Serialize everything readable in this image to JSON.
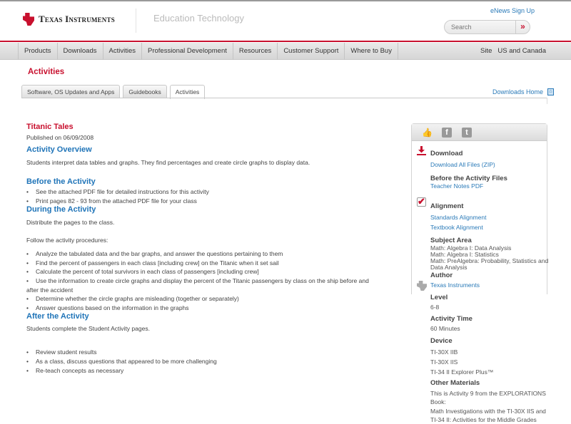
{
  "header": {
    "logo_text": "Texas Instruments",
    "section_title": "Education Technology",
    "enews_link": "eNews Sign Up",
    "search_placeholder": "Search",
    "search_go": "»"
  },
  "nav": {
    "items": [
      "Products",
      "Downloads",
      "Activities",
      "Professional Development",
      "Resources",
      "Customer Support",
      "Where to Buy"
    ],
    "site_label": "Site",
    "site_value": "US and Canada"
  },
  "page": {
    "heading": "Activities",
    "tabs": [
      "Software, OS Updates and Apps",
      "Guidebooks",
      "Activities"
    ],
    "downloads_home": "Downloads Home"
  },
  "activity": {
    "title": "Titanic Tales",
    "published": "Published on 06/09/2008",
    "overview_heading": "Activity Overview",
    "overview_text": "Students interpret data tables and graphs. They find percentages and create circle graphs to display data.",
    "before_heading": "Before the Activity",
    "before_items": [
      "See the attached PDF file for detailed instructions for this activity",
      "Print pages 82 - 93 from the attached PDF file for your class"
    ],
    "during_heading": "During the Activity",
    "during_intro": "Distribute the pages to the class.",
    "during_follow": "Follow the activity procedures:",
    "during_items": [
      "Analyze the tabulated data and the bar graphs, and answer the questions pertaining to them",
      "Find the percent of passengers in each class [including crew] on the Titanic when it set sail",
      "Calculate the percent of total survivors in each class of passengers [including crew]",
      "Use the information to create circle graphs and display the percent of the Titanic passengers by class on the ship before and after the accident",
      "Determine whether the circle graphs are misleading (together or separately)",
      "Answer questions based on the information in the graphs"
    ],
    "after_heading": "After the Activity",
    "after_intro": "Students complete the Student Activity pages.",
    "after_items": [
      "Review student results",
      "As a class, discuss questions that appeared to be more challenging",
      "Re-teach concepts as necessary"
    ]
  },
  "sidebar": {
    "download_heading": "Download",
    "download_all": "Download All Files (ZIP)",
    "before_files_heading": "Before the Activity Files",
    "teacher_notes": "Teacher Notes PDF",
    "alignment_heading": "Alignment",
    "standards": "Standards Alignment",
    "textbook": "Textbook Alignment",
    "subject_heading": "Subject Area",
    "subjects": [
      "Math: Algebra I: Data Analysis",
      "Math: Algebra I: Statistics",
      "Math: PreAlgebra: Probability, Statistics and Data Analysis"
    ],
    "author_heading": "Author",
    "author": "Texas Instruments",
    "level_heading": "Level",
    "level": "6-8",
    "time_heading": "Activity Time",
    "time": "60 Minutes",
    "device_heading": "Device",
    "devices": [
      "TI-30X IIB",
      "TI-30X IIS",
      "TI-34 II Explorer Plus™"
    ],
    "materials_heading": "Other Materials",
    "materials": [
      "This is Activity 9 from the EXPLORATIONS Book:",
      "Math Investigations with the TI-30X IIS and TI-34 II: Activities for the Middle Grades"
    ]
  }
}
